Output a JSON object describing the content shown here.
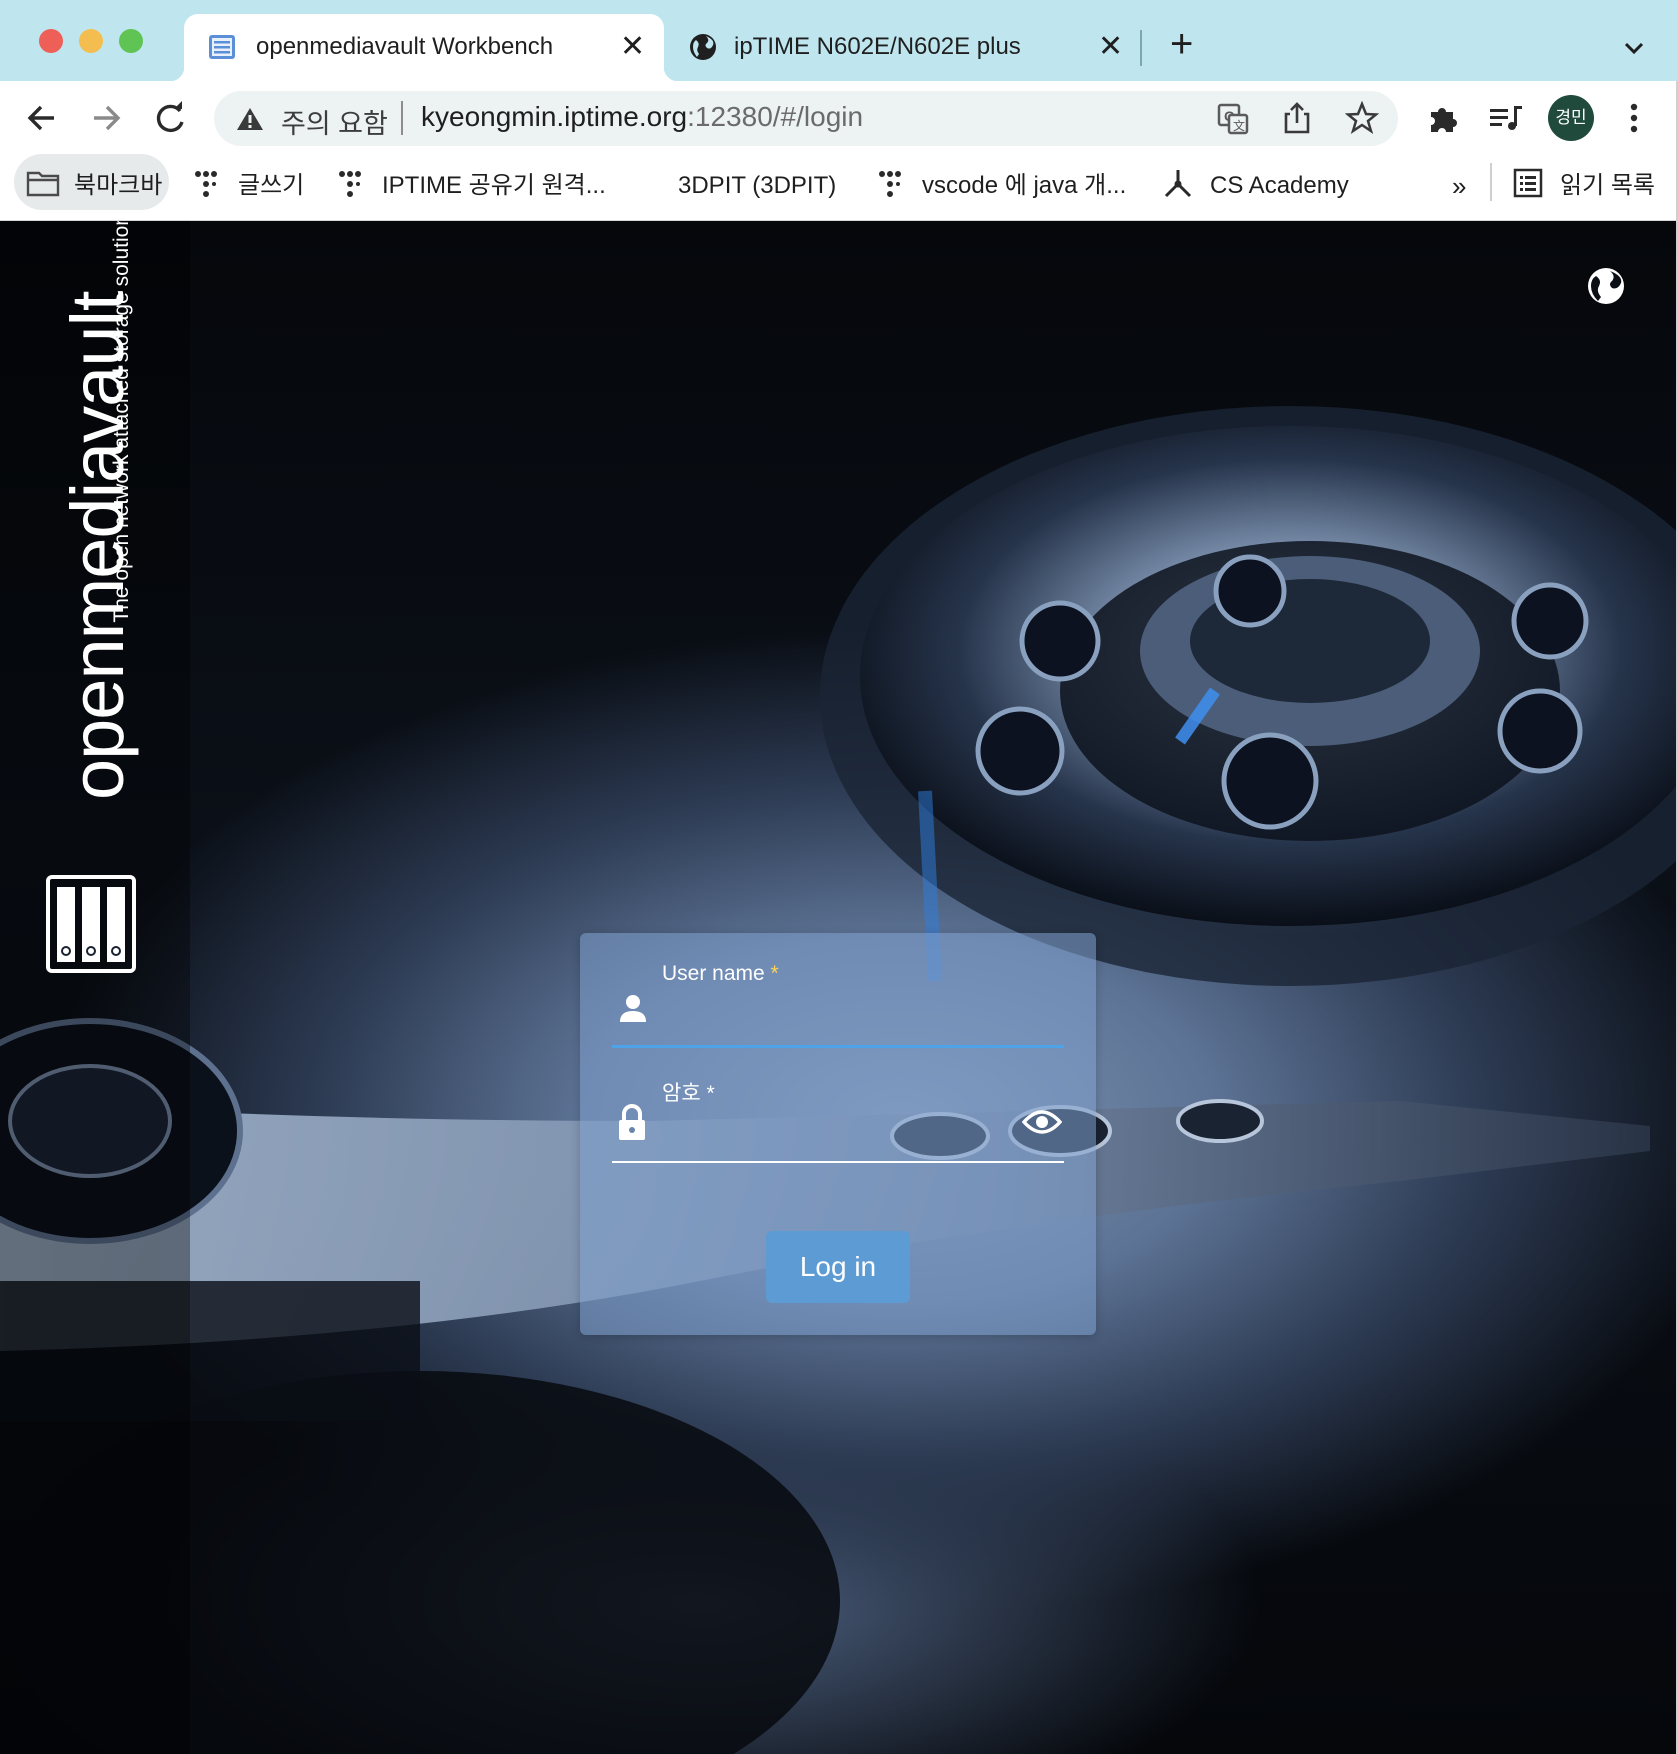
{
  "browser": {
    "tabs": [
      {
        "title": "openmediavault Workbench",
        "active": true
      },
      {
        "title": "ipTIME N602E/N602E plus",
        "active": false
      }
    ],
    "new_tab_label": "+",
    "omnibox": {
      "security_label": "주의 요함",
      "url_host": "kyeongmin.iptime.org",
      "url_path": ":12380/#/login"
    },
    "profile_initials": "경민",
    "bookmarks": [
      {
        "label": "북마크바",
        "icon": "folder-icon"
      },
      {
        "label": "글쓰기",
        "icon": "dots-icon"
      },
      {
        "label": "IPTIME 공유기 원격...",
        "icon": "dots-icon"
      },
      {
        "label": "3DPIT (3DPIT)",
        "icon": ""
      },
      {
        "label": "vscode 에 java 개...",
        "icon": "dots-icon"
      },
      {
        "label": "CS Academy",
        "icon": "academy-icon"
      }
    ],
    "bookmarks_overflow": "»",
    "reading_list_label": "읽기 목록"
  },
  "app": {
    "brand": "openmediavault",
    "tagline": "The open network attached storage solution",
    "login": {
      "username_label": "User name",
      "password_label": "암호",
      "required_mark": "*",
      "submit_label": "Log in"
    }
  },
  "colors": {
    "tabstrip": "#bfe5ee",
    "accent_underline": "#4ea3e8",
    "button": "#5d9bd5",
    "required": "#ffd54f"
  }
}
